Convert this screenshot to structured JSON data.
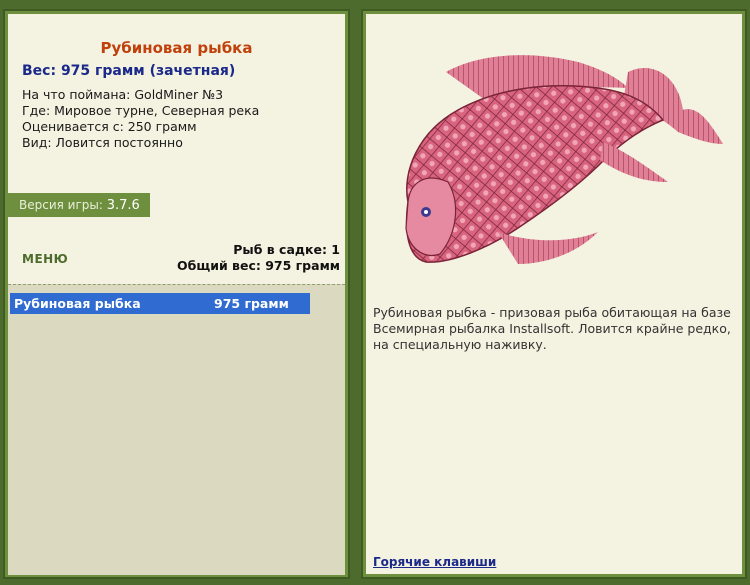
{
  "fish": {
    "name": "Рубиновая рыбка",
    "weight_line": "Вес: 975 грамм (зачетная)",
    "caught_with": "На что поймана: GoldMiner №3",
    "location": "Где: Мировое турне, Северная река",
    "evaluated_from": "Оценивается с: 250 грамм",
    "kind": "Вид: Ловится постоянно"
  },
  "version": {
    "label": "Версия игры:",
    "number": "3.7.6"
  },
  "menu": {
    "label": "МЕНЮ"
  },
  "stats": {
    "fish_count": "Рыб в садке: 1",
    "total_weight": "Общий вес: 975 грамм"
  },
  "catch_list": {
    "rows": [
      {
        "name": "Рубиновая рыбка",
        "weight": "975 грамм"
      }
    ]
  },
  "details": {
    "description": "Рубиновая рыбка - призовая рыба обитающая на базе Всемирная рыбалка Installsoft. Ловится крайне редко, на специальную наживку.",
    "hotkeys_link": "Горячие клавиши"
  },
  "colors": {
    "background": "#4d6b2c",
    "panel": "#f4f2e0",
    "accent": "#6e8f3e",
    "title": "#c0410c",
    "weight": "#1b2a8a",
    "selection": "#2f6bd0",
    "fish": "#c8506e"
  }
}
